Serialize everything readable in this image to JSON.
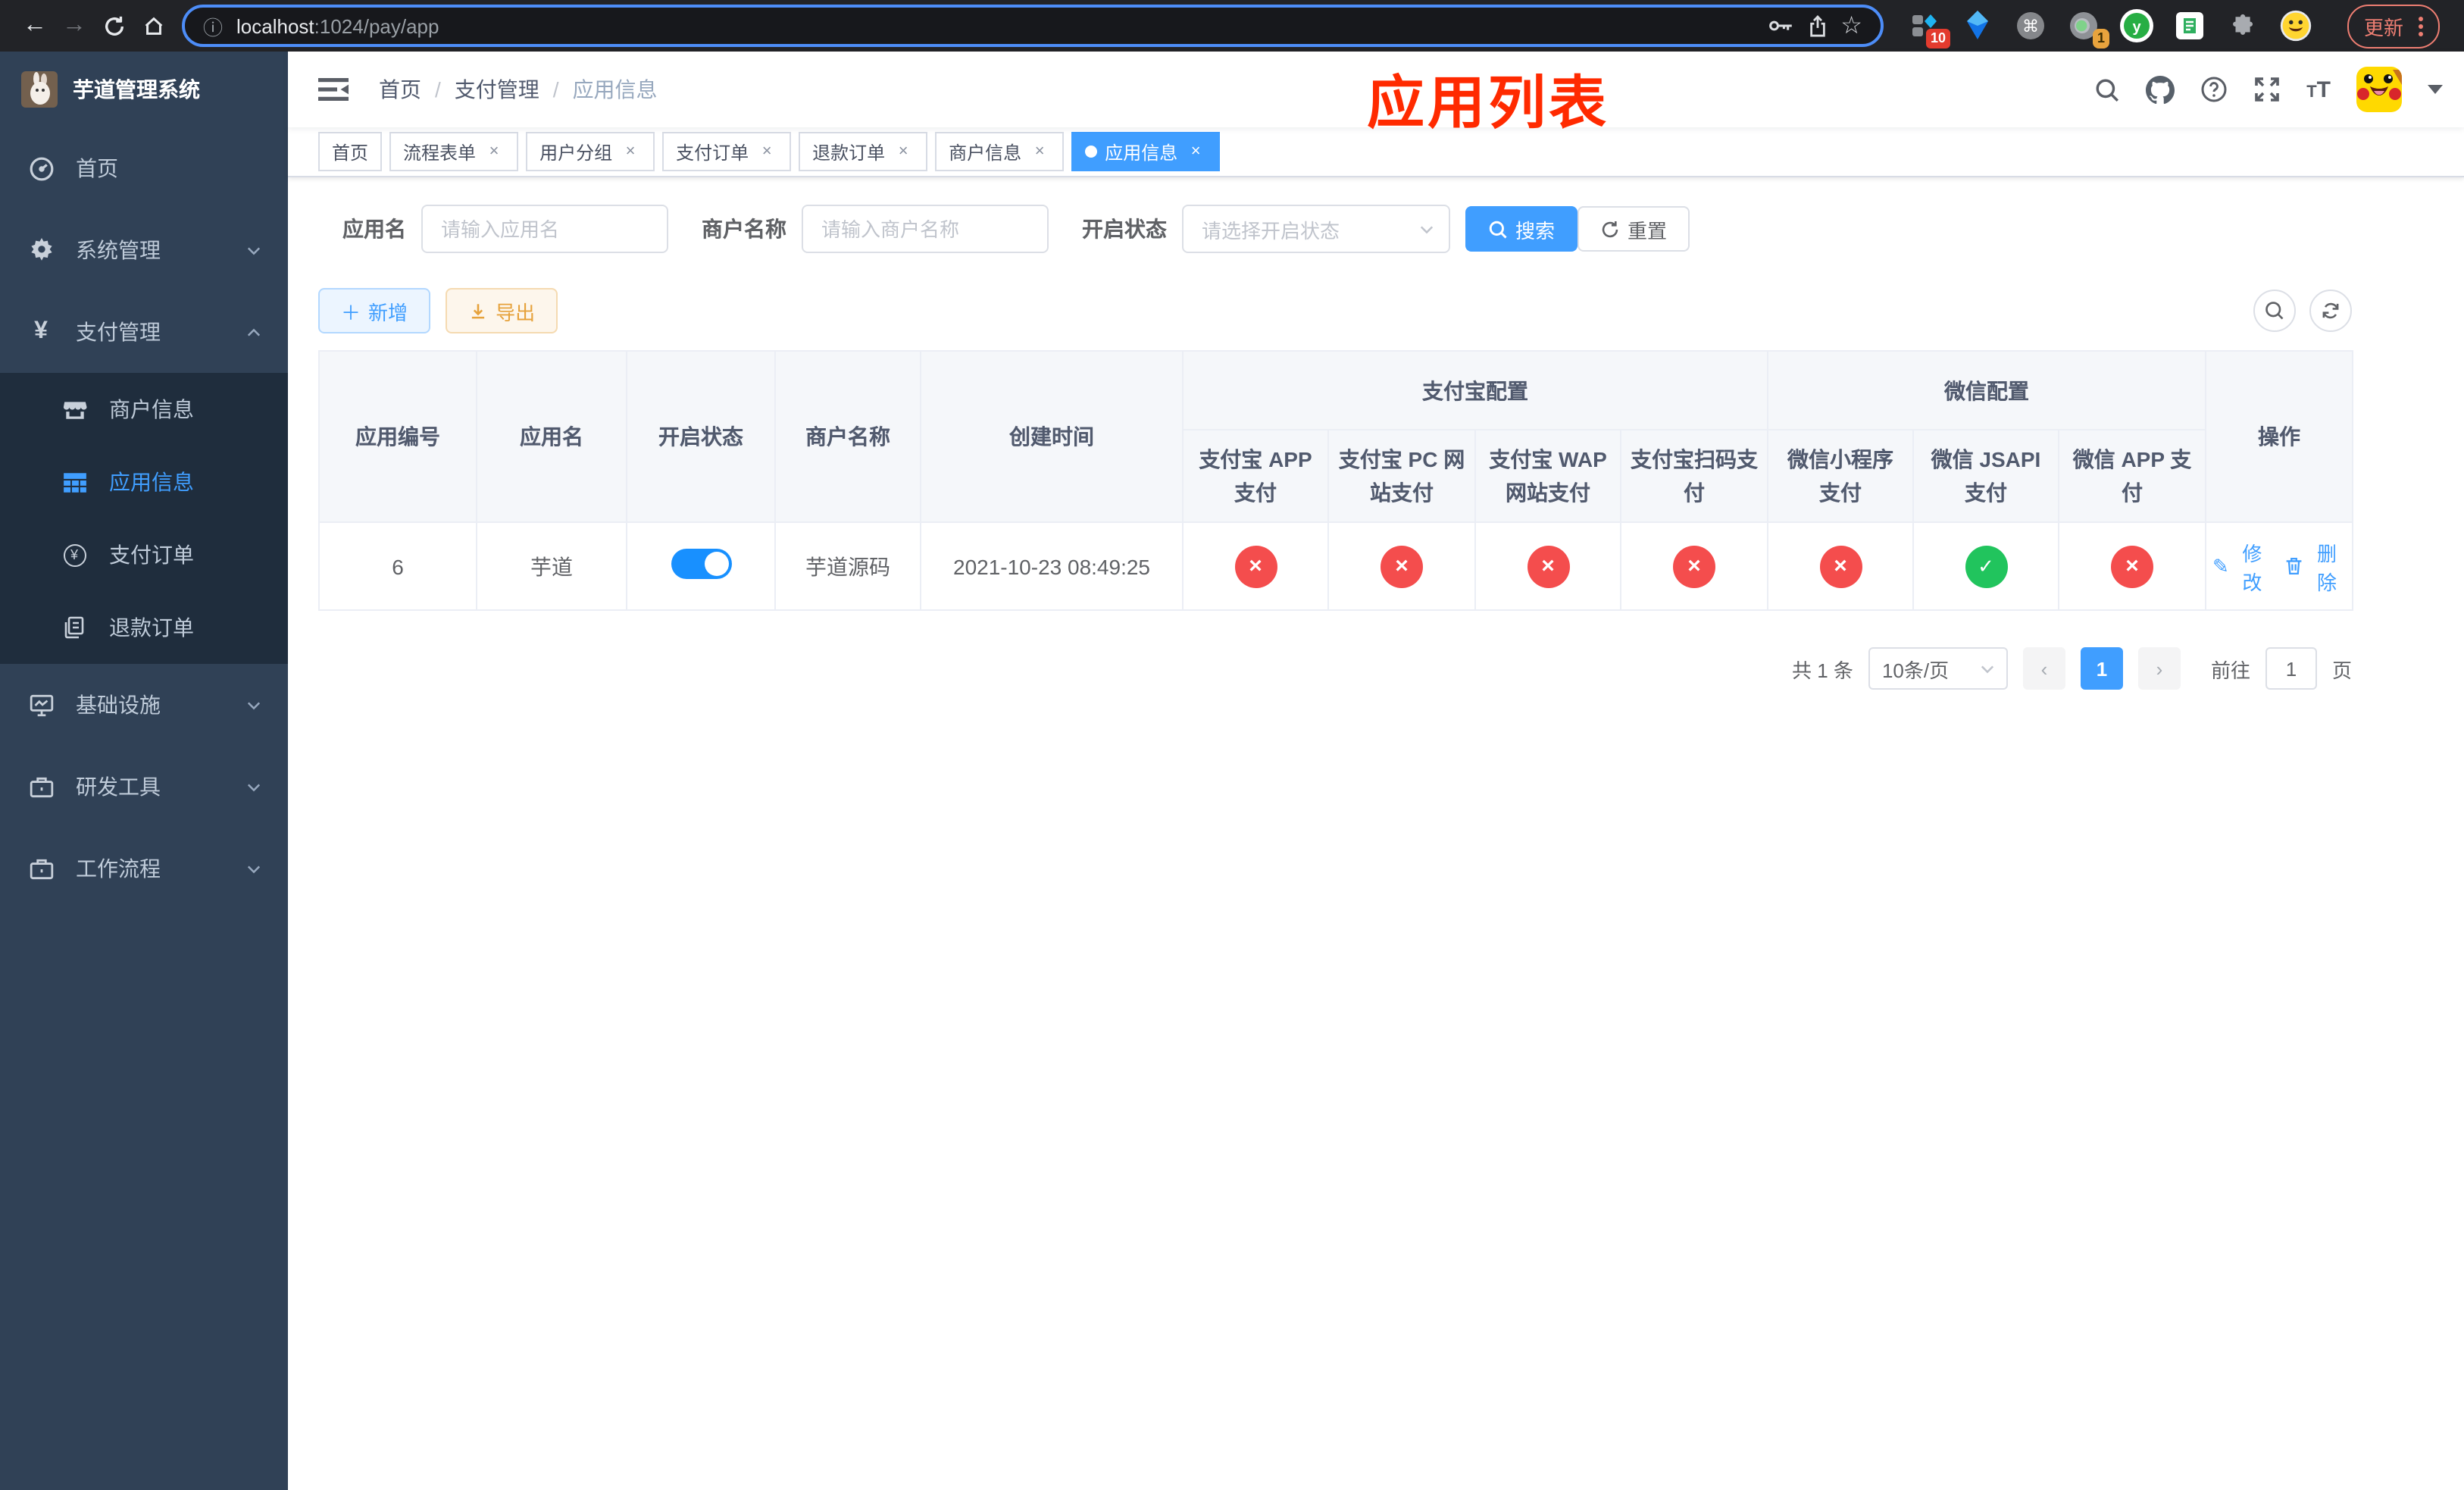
{
  "browser": {
    "url_host": "localhost",
    "url_rest": ":1024/pay/app",
    "ext_badge_blocks": "10",
    "ext_badge_circle": "1",
    "update_label": "更新"
  },
  "sidebar": {
    "title": "芋道管理系统",
    "items": [
      {
        "label": "首页"
      },
      {
        "label": "系统管理"
      },
      {
        "label": "支付管理"
      },
      {
        "label": "基础设施"
      },
      {
        "label": "研发工具"
      },
      {
        "label": "工作流程"
      }
    ],
    "submenu": [
      {
        "label": "商户信息"
      },
      {
        "label": "应用信息"
      },
      {
        "label": "支付订单"
      },
      {
        "label": "退款订单"
      }
    ]
  },
  "navbar": {
    "breadcrumb": [
      "首页",
      "支付管理",
      "应用信息"
    ],
    "separator": "/",
    "annotation": "应用列表"
  },
  "tags": [
    {
      "label": "首页"
    },
    {
      "label": "流程表单"
    },
    {
      "label": "用户分组"
    },
    {
      "label": "支付订单"
    },
    {
      "label": "退款订单"
    },
    {
      "label": "商户信息"
    },
    {
      "label": "应用信息"
    }
  ],
  "filter": {
    "app_name_label": "应用名",
    "app_name_placeholder": "请输入应用名",
    "merchant_label": "商户名称",
    "merchant_placeholder": "请输入商户名称",
    "status_label": "开启状态",
    "status_placeholder": "请选择开启状态",
    "search_label": "搜索",
    "reset_label": "重置"
  },
  "toolbar": {
    "add_label": "新增",
    "export_label": "导出"
  },
  "table": {
    "groups": {
      "alipay": "支付宝配置",
      "wechat": "微信配置"
    },
    "columns": {
      "id": "应用编号",
      "name": "应用名",
      "status": "开启状态",
      "merchant": "商户名称",
      "created": "创建时间",
      "alipay_app": "支付宝 APP 支付",
      "alipay_pc": "支付宝 PC 网站支付",
      "alipay_wap": "支付宝 WAP 网站支付",
      "alipay_qr": "支付宝扫码支付",
      "wx_mini": "微信小程序支付",
      "wx_jsapi": "微信 JSAPI 支付",
      "wx_app": "微信 APP 支付",
      "actions": "操作"
    },
    "row": {
      "id": "6",
      "name": "芋道",
      "switch_on": "true",
      "merchant": "芋道源码",
      "created": "2021-10-23 08:49:25",
      "statuses": [
        "fail",
        "fail",
        "fail",
        "fail",
        "fail",
        "success",
        "fail"
      ],
      "edit_label": "修改",
      "delete_label": "删除"
    }
  },
  "pagination": {
    "total": "共 1 条",
    "page_size": "10条/页",
    "page": "1",
    "goto_label": "前往",
    "goto_value": "1",
    "page_unit": "页"
  },
  "colors": {
    "accent": "#409eff",
    "switch_on": "#1890ff",
    "danger": "#f44d4d",
    "success": "#21c45d",
    "annotation": "#ff2a00",
    "sidebar_bg": "#304156",
    "submenu_bg": "#1f2d3d"
  }
}
